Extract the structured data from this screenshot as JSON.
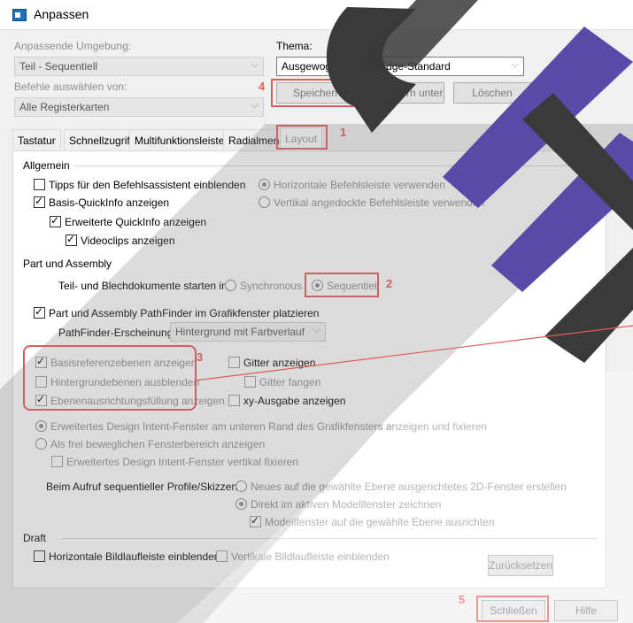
{
  "window": {
    "title": "Anpassen"
  },
  "left": {
    "environment_label": "Anpassende Umgebung:",
    "environment_value": "Teil - Sequentiell",
    "commands_label": "Befehle auswählen von:",
    "commands_value": "Alle Registerkarten"
  },
  "theme": {
    "label": "Thema:",
    "value": "Ausgewogen - Solid Edge-Standard",
    "save_label": "Speichern",
    "save_as_label": "Speichern unter",
    "delete_label": "Löschen"
  },
  "tabs": [
    "Tastatur",
    "Schnellzugriff",
    "Multifunktionsleiste",
    "Radialmenü",
    "Layout"
  ],
  "general": {
    "heading": "Allgemein",
    "tips": "Tipps für den Befehlsassistent einblenden",
    "basic_quickinfo": "Basis-QuickInfo anzeigen",
    "extended_quickinfo": "Erweiterte QuickInfo anzeigen",
    "videoclips": "Videoclips anzeigen",
    "horizontal_cmdbar": "Horizontale Befehlsleiste verwenden",
    "vertical_cmdbar": "Vertikal angedockte Befehlsleiste verwenden"
  },
  "part": {
    "heading": "Part und Assembly",
    "start_label": "Teil- und Blechdokumente starten in:",
    "synchronous": "Synchronous",
    "sequential": "Sequentiell",
    "pathfinder": "Part und Assembly PathFinder im Grafikfenster platzieren",
    "pathfinder_look_label": "PathFinder-Erscheinung:",
    "pathfinder_look_value": "Hintergrund mit Farbverlauf",
    "show_basis_refs": "Basisreferenzebenen anzeigen",
    "hide_basis_refs": "Hintergrundebenen ausblenden",
    "plane_axes": "Ebenenausrichtungsfüllung anzeigen",
    "grid": "Gitter anzeigen",
    "snap_grid": "Gitter fangen",
    "xy_display": "xy-Ausgabe anzeigen",
    "intent_dock": "Erweitertes Design Intent-Fenster am unteren Rand des Grafikfensters anzeigen und fixieren",
    "intent_float": "Als frei beweglichen Fensterbereich anzeigen",
    "intent_vertical": "Erweitertes Design Intent-Fenster vertikal fixieren",
    "profile_label": "Beim Aufruf sequentieller Profile/Skizzen:",
    "new_window": "Neues auf die gewählte Ebene ausgerichtetes 2D-Fenster erstellen",
    "draw_active": "Direkt im aktiven Modellfenster zeichnen",
    "align_model": "Modellfenster auf die gewählte Ebene ausrichten"
  },
  "draft": {
    "heading": "Draft",
    "horizontal_scroll": "Horizontale Bildlaufleiste einblenden",
    "vertical_scroll": "Vertikale Bildlaufleiste einblenden"
  },
  "buttons": {
    "reset": "Zurücksetzen",
    "close": "Schließen",
    "help": "Hilfe"
  },
  "annotations": [
    "1",
    "2",
    "3",
    "4",
    "5"
  ],
  "colors": {
    "annotation_red": "#e05b5b",
    "logo_purple": "#5a4aa8",
    "logo_dark": "#3a3a3a"
  }
}
